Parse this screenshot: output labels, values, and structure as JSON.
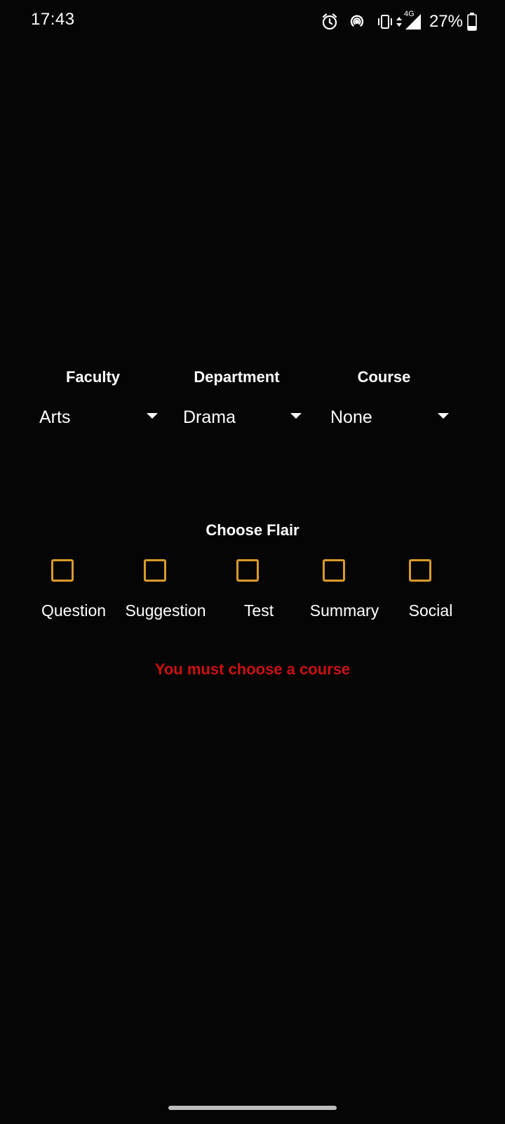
{
  "status_bar": {
    "time": "17:43",
    "battery_percent": "27%",
    "network": "4G",
    "icons": [
      "alarm-icon",
      "hotspot-icon",
      "vibrate-icon",
      "data-arrows-icon",
      "signal-icon",
      "battery-icon"
    ]
  },
  "selectors": {
    "faculty": {
      "label": "Faculty",
      "value": "Arts"
    },
    "department": {
      "label": "Department",
      "value": "Drama"
    },
    "course": {
      "label": "Course",
      "value": "None"
    }
  },
  "flair": {
    "title": "Choose Flair",
    "options": [
      {
        "label": "Question",
        "checked": false
      },
      {
        "label": "Suggestion",
        "checked": false
      },
      {
        "label": "Test",
        "checked": false
      },
      {
        "label": "Summary",
        "checked": false
      },
      {
        "label": "Social",
        "checked": false
      }
    ]
  },
  "error_message": "You must choose a course",
  "colors": {
    "background": "#050505",
    "checkbox_accent": "#d99a2b",
    "error": "#cc1111",
    "text": "#ffffff"
  }
}
